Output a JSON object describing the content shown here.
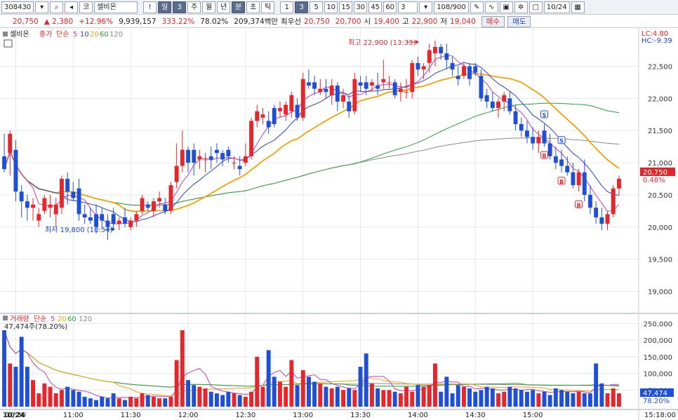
{
  "toolbar": {
    "code": "308430",
    "market_label": "코",
    "name": "셀비온",
    "period_buttons": [
      "일",
      "3",
      "주",
      "월",
      "년",
      "분",
      "초",
      "틱"
    ],
    "interval_buttons": [
      "1",
      "3",
      "5",
      "10",
      "15",
      "30",
      "45",
      "60"
    ],
    "interval_value": "3",
    "count": "108/900",
    "date": "10/24"
  },
  "quote": {
    "price": "20,750",
    "change": "▲ 2,380",
    "change_pct": "+12.96%",
    "volume": "9,939,157",
    "turnover_ratio": "333.22%",
    "ratio2": "78.02%",
    "amount": "209,374백만",
    "best_label": "최우선",
    "ask": "20,750",
    "bid": "20,700",
    "open_label": "시",
    "open": "19,400",
    "high_label": "고",
    "high": "22,900",
    "low_label": "저",
    "low": "19,040",
    "buy_button": "매수",
    "sell_button": "매도"
  },
  "colors": {
    "up": "#e8252b",
    "down": "#1e4fd8",
    "ma5": "#c23fb5",
    "ma10": "#2a3fc4",
    "ma20": "#f2a300",
    "ma60": "#2e9e3a",
    "ma120": "#8a8a8a",
    "bg": "#ffffff",
    "grid": "#e4e8ef",
    "price_box": "#e0262a"
  },
  "chart_data": [
    {
      "type": "candlestick",
      "legend_name": "셀비온",
      "legend_ma": [
        "종가",
        "단순",
        "5",
        "10",
        "20",
        "60",
        "120"
      ],
      "y_ticks": [
        19000,
        19500,
        20000,
        20500,
        21000,
        21500,
        22000,
        22500
      ],
      "ylim": [
        18700,
        23050
      ],
      "x_ticks": [
        "10/24",
        "10:30",
        "11:00",
        "11:30",
        "12:00",
        "12:30",
        "13:00",
        "13:30",
        "14:00",
        "14:30",
        "15:00",
        "15:18:00"
      ],
      "annotations": {
        "high": "최고 22,900 (13:33)",
        "low": "최저 19,800 (10:54)"
      },
      "lc_label": "LC:4.80",
      "hc_label": "HC:-9.39",
      "current_price": "20,750",
      "current_pct": "0.48%",
      "signals": [
        "S",
        "S",
        "B",
        "B",
        "B"
      ],
      "candles": [
        [
          21100,
          21450,
          20850,
          20900
        ],
        [
          21150,
          21500,
          20800,
          21450
        ],
        [
          21200,
          21350,
          20400,
          20550
        ],
        [
          20550,
          20650,
          20150,
          20400
        ],
        [
          20400,
          20500,
          20100,
          20300
        ],
        [
          20300,
          20450,
          20100,
          20350
        ],
        [
          20100,
          20300,
          20000,
          20200
        ],
        [
          20250,
          20500,
          20200,
          20450
        ],
        [
          20300,
          20500,
          20150,
          20350
        ],
        [
          20200,
          20450,
          20000,
          20350
        ],
        [
          20300,
          20800,
          20200,
          20750
        ],
        [
          20750,
          20850,
          20350,
          20550
        ],
        [
          20550,
          20700,
          20400,
          20450
        ],
        [
          20600,
          20750,
          20100,
          20200
        ],
        [
          20200,
          20350,
          20050,
          20150
        ],
        [
          20150,
          20300,
          20050,
          20100
        ],
        [
          20200,
          20350,
          19900,
          20000
        ],
        [
          20200,
          20300,
          20000,
          20100
        ],
        [
          20100,
          20200,
          19800,
          20000
        ],
        [
          20200,
          20300,
          19950,
          20050
        ],
        [
          20050,
          20150,
          19950,
          20100
        ],
        [
          20150,
          20300,
          20000,
          20050
        ],
        [
          20000,
          20150,
          19950,
          20100
        ],
        [
          20100,
          20250,
          20000,
          20200
        ],
        [
          20250,
          20500,
          20200,
          20450
        ],
        [
          20350,
          20400,
          20250,
          20300
        ],
        [
          20250,
          20450,
          20150,
          20400
        ],
        [
          20400,
          20550,
          20300,
          20450
        ],
        [
          20350,
          20450,
          20200,
          20250
        ],
        [
          20250,
          20700,
          20200,
          20650
        ],
        [
          20700,
          21300,
          20600,
          20950
        ],
        [
          20950,
          21500,
          20850,
          21200
        ],
        [
          21200,
          21250,
          20850,
          21000
        ],
        [
          21200,
          21300,
          20800,
          21000
        ],
        [
          21050,
          21200,
          20900,
          21100
        ],
        [
          21050,
          21150,
          20850,
          21050
        ],
        [
          21100,
          21250,
          20900,
          21050
        ],
        [
          21200,
          21300,
          21000,
          21150
        ],
        [
          21150,
          21200,
          20950,
          21050
        ],
        [
          21200,
          21250,
          21000,
          21100
        ],
        [
          21000,
          21100,
          20900,
          21000
        ],
        [
          20950,
          21100,
          20800,
          20900
        ],
        [
          21000,
          21300,
          20950,
          21100
        ],
        [
          21100,
          21700,
          21050,
          21650
        ],
        [
          21650,
          21900,
          21550,
          21800
        ],
        [
          21700,
          21850,
          21600,
          21750
        ],
        [
          21650,
          21800,
          21450,
          21550
        ],
        [
          21850,
          21900,
          21550,
          21600
        ],
        [
          21800,
          21950,
          21700,
          21850
        ],
        [
          21750,
          21950,
          21650,
          21900
        ],
        [
          21800,
          22100,
          21700,
          22050
        ],
        [
          21900,
          22000,
          21650,
          21700
        ],
        [
          21700,
          22400,
          21650,
          22300
        ],
        [
          22250,
          22450,
          22150,
          22200
        ],
        [
          22250,
          22350,
          22050,
          22150
        ],
        [
          22100,
          22300,
          22050,
          22150
        ],
        [
          22150,
          22300,
          22000,
          22100
        ],
        [
          22050,
          22300,
          21900,
          22200
        ],
        [
          22200,
          22250,
          21800,
          21950
        ],
        [
          21950,
          22150,
          21850,
          22050
        ],
        [
          21950,
          22050,
          21700,
          21800
        ],
        [
          21800,
          22400,
          21750,
          22300
        ],
        [
          22250,
          22350,
          22100,
          22200
        ],
        [
          22250,
          22350,
          22050,
          22150
        ],
        [
          22200,
          22300,
          22100,
          22250
        ],
        [
          22200,
          22400,
          22050,
          22150
        ],
        [
          22250,
          22600,
          22150,
          22300
        ],
        [
          22250,
          22350,
          22150,
          22250
        ],
        [
          22250,
          22300,
          22000,
          22050
        ],
        [
          22100,
          22250,
          21950,
          22150
        ],
        [
          22100,
          22300,
          22000,
          22100
        ],
        [
          22100,
          22600,
          22000,
          22550
        ],
        [
          22550,
          22650,
          22350,
          22450
        ],
        [
          22450,
          22550,
          22300,
          22500
        ],
        [
          22550,
          22850,
          22400,
          22750
        ],
        [
          22700,
          22900,
          22500,
          22800
        ],
        [
          22800,
          22850,
          22600,
          22700
        ],
        [
          22700,
          22850,
          22450,
          22600
        ],
        [
          22550,
          22650,
          22350,
          22450
        ],
        [
          22350,
          22500,
          22200,
          22300
        ],
        [
          22350,
          22550,
          22300,
          22500
        ],
        [
          22500,
          22550,
          22200,
          22300
        ],
        [
          22500,
          22550,
          22350,
          22400
        ],
        [
          22350,
          22450,
          21950,
          22000
        ],
        [
          22050,
          22150,
          21850,
          21950
        ],
        [
          21950,
          22100,
          21800,
          21850
        ],
        [
          21850,
          22000,
          21700,
          21950
        ],
        [
          21950,
          22100,
          21800,
          22050
        ],
        [
          22000,
          22100,
          21750,
          21800
        ],
        [
          21800,
          21900,
          21500,
          21600
        ],
        [
          21600,
          21700,
          21400,
          21500
        ],
        [
          21500,
          21650,
          21300,
          21400
        ],
        [
          21400,
          21550,
          21200,
          21300
        ],
        [
          21300,
          21500,
          21150,
          21400
        ],
        [
          21500,
          21600,
          21250,
          21300
        ],
        [
          21300,
          21450,
          21050,
          21100
        ],
        [
          21100,
          21250,
          20900,
          21000
        ],
        [
          21050,
          21200,
          20850,
          20950
        ],
        [
          20950,
          21100,
          20800,
          20850
        ],
        [
          20850,
          21000,
          20600,
          20650
        ],
        [
          20650,
          20900,
          20550,
          20850
        ],
        [
          20850,
          21050,
          20400,
          20500
        ],
        [
          20500,
          20650,
          20200,
          20300
        ],
        [
          20300,
          20400,
          20050,
          20150
        ],
        [
          20150,
          20300,
          19950,
          20050
        ],
        [
          20050,
          20250,
          19950,
          20200
        ],
        [
          20200,
          20650,
          20150,
          20600
        ],
        [
          20600,
          20800,
          20500,
          20750
        ]
      ]
    },
    {
      "type": "bar",
      "legend_name": "거래량",
      "legend_ma": [
        "단순",
        "5",
        "20",
        "60",
        "120"
      ],
      "value_label": "47,474주(78.20%)",
      "y_ticks": [
        50000,
        100000,
        150000,
        200000,
        250000
      ],
      "ylim": [
        0,
        270000
      ],
      "current_volume": "47,474",
      "current_pct": "78.20%",
      "volumes": [
        230000,
        130000,
        120000,
        210000,
        120000,
        80000,
        40000,
        70000,
        60000,
        40000,
        50000,
        60000,
        50000,
        45000,
        30000,
        25000,
        20000,
        30000,
        25000,
        40000,
        25000,
        20000,
        30000,
        25000,
        40000,
        35000,
        30000,
        25000,
        25000,
        30000,
        140000,
        230000,
        80000,
        65000,
        60000,
        55000,
        45000,
        40000,
        35000,
        45000,
        40000,
        35000,
        30000,
        45000,
        150000,
        60000,
        170000,
        90000,
        75000,
        60000,
        140000,
        65000,
        110000,
        90000,
        75000,
        70000,
        60000,
        55000,
        60000,
        50000,
        55000,
        50000,
        120000,
        160000,
        70000,
        55000,
        50000,
        50000,
        45000,
        40000,
        60000,
        45000,
        65000,
        60000,
        65000,
        130000,
        45000,
        90000,
        40000,
        65000,
        60000,
        55000,
        45000,
        50000,
        60000,
        55000,
        40000,
        45000,
        60000,
        55000,
        50000,
        45000,
        50000,
        40000,
        45000,
        35000,
        55000,
        50000,
        45000,
        40000,
        45000,
        40000,
        40000,
        130000,
        70000,
        40000,
        55000,
        40000
      ]
    }
  ]
}
